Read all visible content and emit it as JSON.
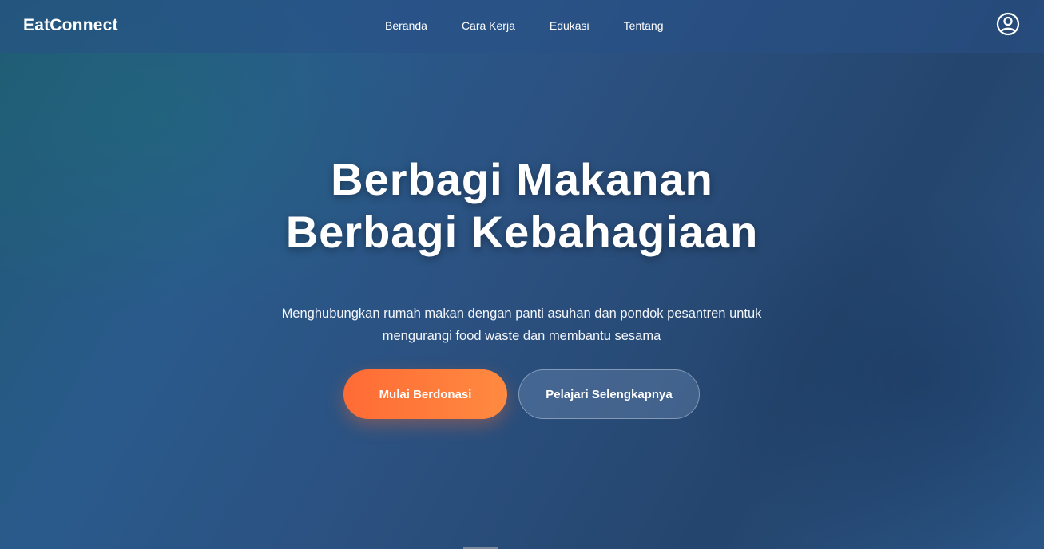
{
  "header": {
    "brand": "EatConnect",
    "nav": [
      "Beranda",
      "Cara Kerja",
      "Edukasi",
      "Tentang"
    ],
    "user_icon": "user-circle-icon"
  },
  "hero": {
    "title_line1": "Berbagi Makanan",
    "title_line2": "Berbagi Kebahagiaan",
    "subtitle_line1": "Menghubungkan rumah makan dengan panti asuhan dan pondok pesantren untuk",
    "subtitle_line2": "mengurangi food waste dan membantu sesama",
    "primary_button": "Mulai Berdonasi",
    "secondary_button": "Pelajari Selengkapnya"
  },
  "colors": {
    "accent": "#ff6b35",
    "background": "#2a5585",
    "text": "#ffffff"
  }
}
